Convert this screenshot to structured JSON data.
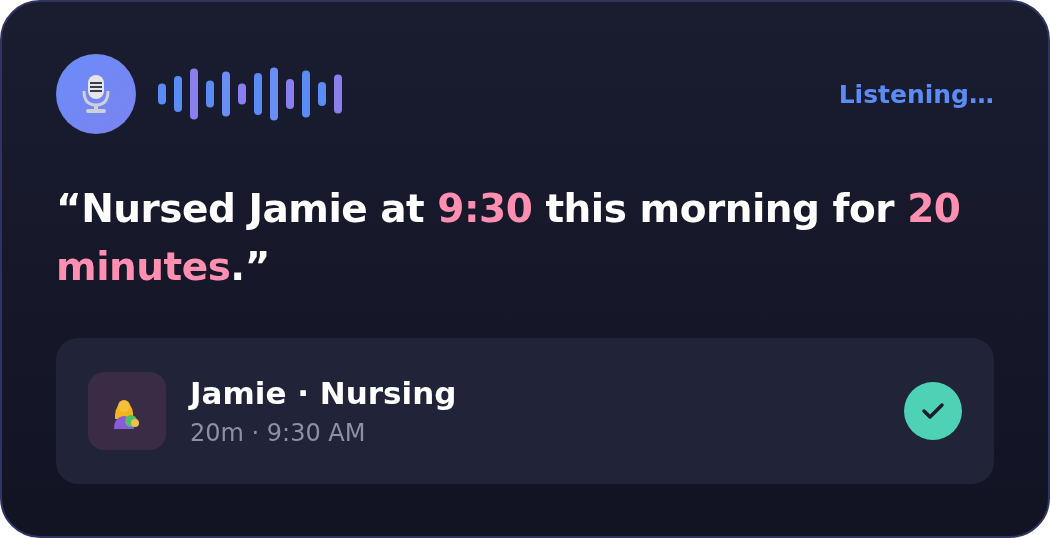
{
  "status": "Listening…",
  "quote": [
    {
      "text": "“Nursed Jamie at ",
      "kind": "plain"
    },
    {
      "text": "9:30",
      "kind": "highlight"
    },
    {
      "text": " this morning for ",
      "kind": "plain"
    },
    {
      "text": "20 minutes",
      "kind": "highlight"
    },
    {
      "text": ".”",
      "kind": "plain"
    }
  ],
  "entry": {
    "title": "Jamie · Nursing",
    "subtitle": "20m · 9:30 AM",
    "confirmed": true
  }
}
